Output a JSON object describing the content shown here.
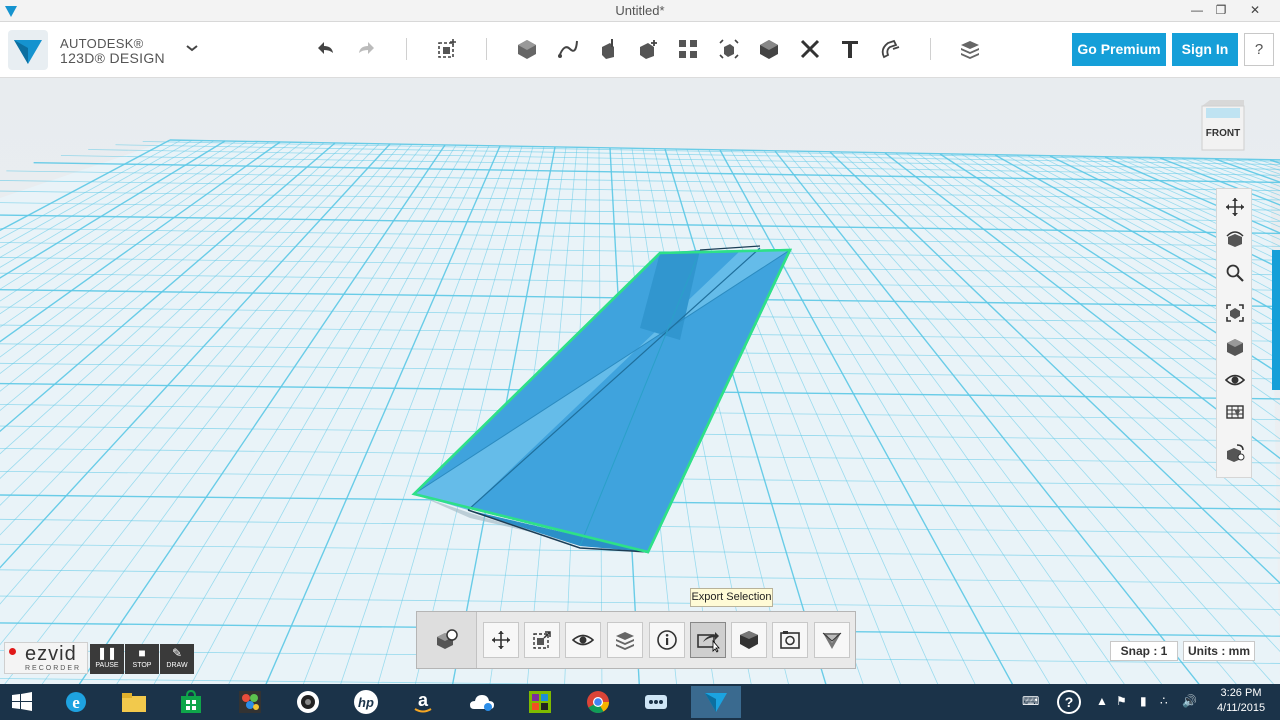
{
  "window": {
    "title": "Untitled*",
    "controls": [
      "minimize-icon",
      "restore-icon",
      "close-icon"
    ]
  },
  "brand": {
    "line1": "AUTODESK®",
    "line2": "123D® DESIGN"
  },
  "toolbar": {
    "icons": [
      "undo-icon",
      "redo-icon",
      "transform-icon",
      "primitives-icon",
      "sketch-icon",
      "construct-icon",
      "modify-icon",
      "pattern-icon",
      "grouping-icon",
      "combine-icon",
      "measure-icon",
      "text-icon",
      "snap-icon",
      "materials-icon"
    ],
    "premium_label": "Go Premium",
    "signin_label": "Sign In",
    "help_label": "?"
  },
  "viewcube": {
    "face_label": "FRONT"
  },
  "nav_panel": {
    "icons": [
      "pan-icon",
      "orbit-icon",
      "zoom-icon",
      "fit-icon",
      "views-icon",
      "visibility-icon",
      "materials-display-icon",
      "grid-settings-icon"
    ]
  },
  "tooltip": {
    "text": "Export Selection"
  },
  "bottom_bar": {
    "icons": [
      "select-object-icon",
      "move-icon",
      "scale-icon",
      "hide-icon",
      "layers-icon",
      "info-icon",
      "export-selection-icon",
      "solid-icon",
      "screenshot-icon",
      "smooth-icon"
    ],
    "active": "export-selection-icon"
  },
  "status": {
    "snap_label": "Snap : 1",
    "units_label": "Units : mm"
  },
  "recorder": {
    "name": "ezvid",
    "sub": "RECORDER",
    "pause_label": "PAUSE",
    "stop_label": "STOP",
    "draw_label": "DRAW"
  },
  "taskbar": {
    "apps": [
      "windows-start-icon",
      "internet-explorer-icon",
      "file-explorer-icon",
      "store-icon",
      "paint-icon",
      "media-icon",
      "hp-icon",
      "amazon-icon",
      "weather-icon",
      "movie-maker-icon",
      "chrome-icon",
      "network-app-icon",
      "123d-design-icon"
    ],
    "time": "3:26 PM",
    "date": "4/11/2015"
  },
  "colors": {
    "accent": "#159fd8",
    "grid_line": "#5cc8e6",
    "shape_fill": "#59b6e6",
    "selection_outline": "#2fe08a",
    "taskbar": "#1b3349"
  }
}
